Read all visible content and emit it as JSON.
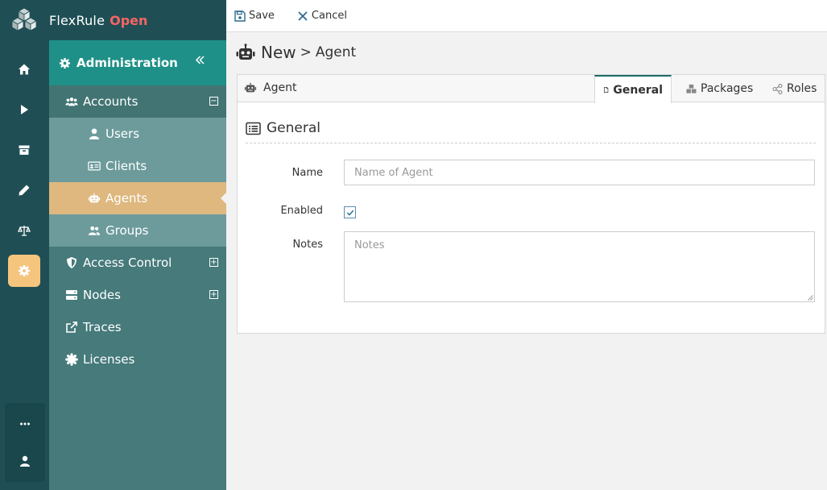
{
  "brand": {
    "name": "FlexRule",
    "edition": "Open"
  },
  "rail": {
    "items": [
      {
        "icon": "home-icon"
      },
      {
        "icon": "play-icon"
      },
      {
        "icon": "archive-icon"
      },
      {
        "icon": "pencil-icon"
      },
      {
        "icon": "balance-scale-icon"
      },
      {
        "icon": "gear-icon",
        "active": true
      }
    ],
    "bottom": [
      {
        "icon": "ellipsis-icon"
      },
      {
        "icon": "user-icon"
      }
    ],
    "active_color": "#f5c57e"
  },
  "sidebar": {
    "header": "Administration",
    "items": [
      {
        "label": "Accounts",
        "icon": "users-icon",
        "toggle": "−"
      },
      {
        "label": "Users",
        "icon": "user-icon"
      },
      {
        "label": "Clients",
        "icon": "id-card-icon"
      },
      {
        "label": "Agents",
        "icon": "robot-icon",
        "active": true
      },
      {
        "label": "Groups",
        "icon": "group-icon"
      },
      {
        "label": "Access Control",
        "icon": "shield-icon",
        "toggle": "+"
      },
      {
        "label": "Nodes",
        "icon": "server-icon",
        "toggle": "+"
      },
      {
        "label": "Traces",
        "icon": "external-link-icon"
      },
      {
        "label": "Licenses",
        "icon": "certificate-icon"
      }
    ]
  },
  "toolbar": {
    "save_label": "Save",
    "cancel_label": "Cancel"
  },
  "page": {
    "title": "New",
    "separator": ">",
    "subtitle": "Agent"
  },
  "panel": {
    "title": "Agent",
    "tabs": [
      {
        "label": "General",
        "icon": "file-icon",
        "active": true
      },
      {
        "label": "Packages",
        "icon": "cubes-icon"
      },
      {
        "label": "Roles",
        "icon": "share-nodes-icon"
      }
    ],
    "section": "General",
    "form": {
      "name_label": "Name",
      "name_placeholder": "Name of Agent",
      "enabled_label": "Enabled",
      "enabled": true,
      "notes_label": "Notes",
      "notes_placeholder": "Notes"
    }
  }
}
